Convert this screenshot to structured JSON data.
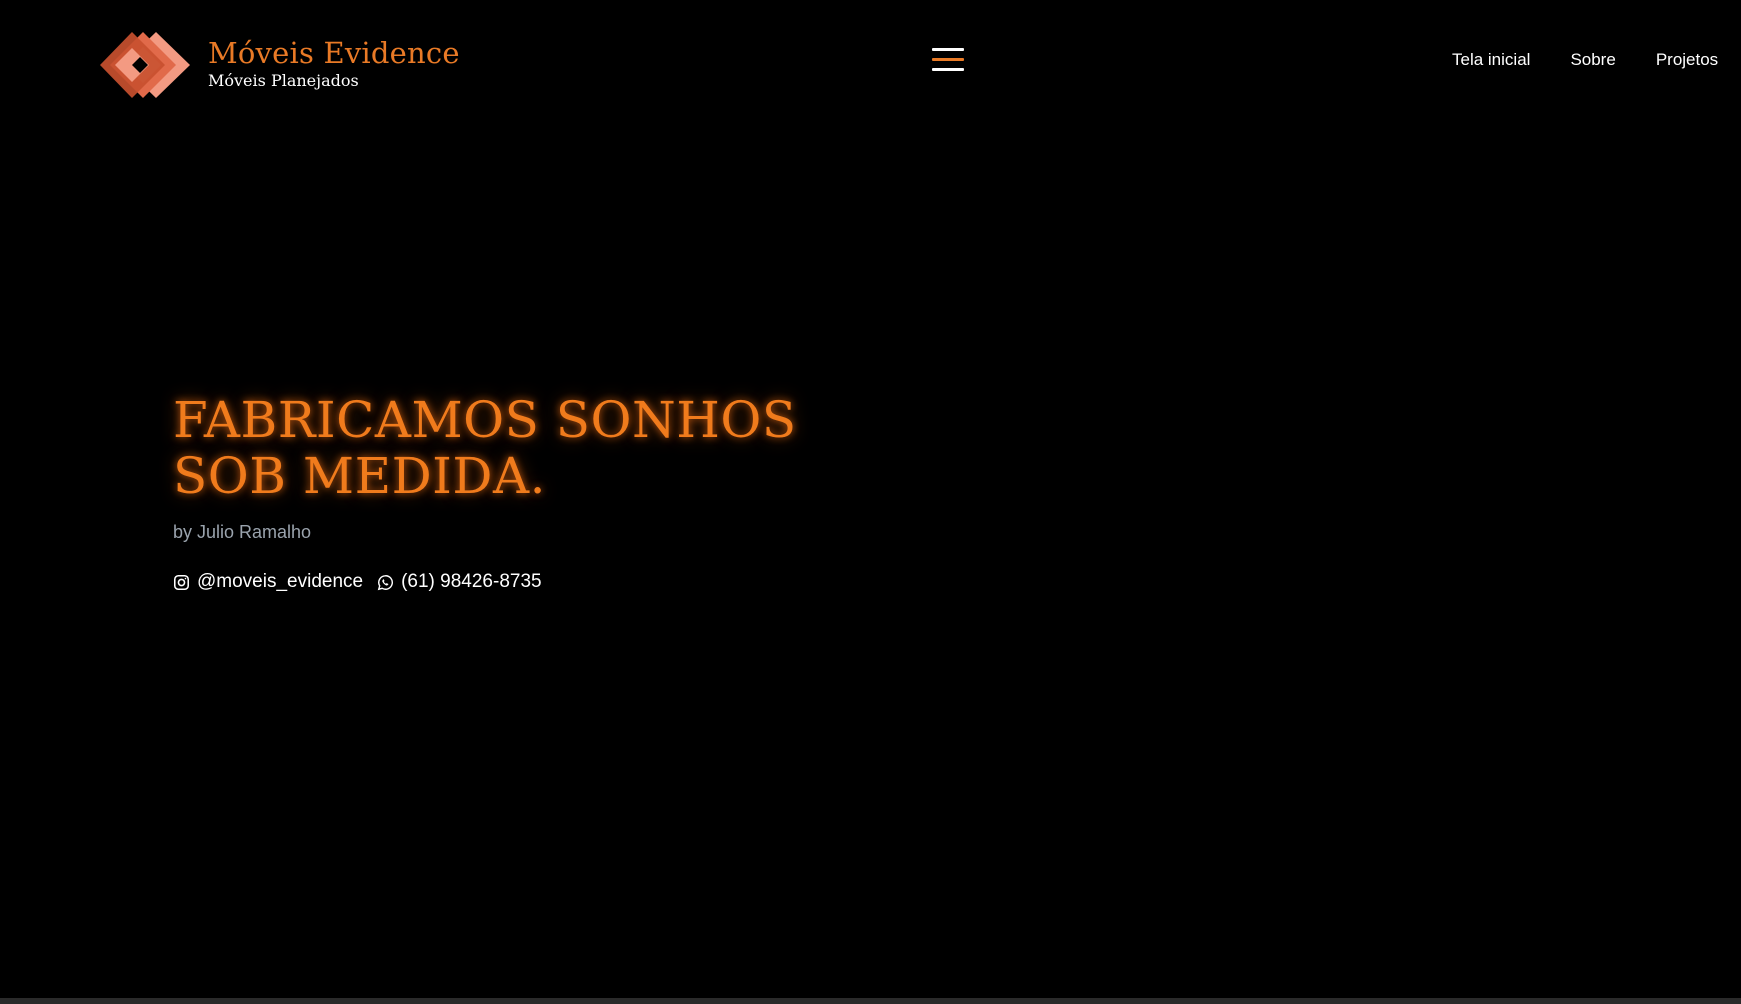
{
  "brand": {
    "name": "Móveis Evidence",
    "tagline": "Móveis Planejados",
    "logo_icon": "nested-diamond-logo-icon",
    "colors": {
      "accent": "#e97a26",
      "logo_dark": "#c8502f",
      "logo_mid": "#e16a4a",
      "logo_light": "#f39a82"
    }
  },
  "header": {
    "menu_icon": "hamburger-menu-icon",
    "nav": [
      {
        "label": "Tela inicial"
      },
      {
        "label": "Sobre"
      },
      {
        "label": "Projetos"
      }
    ]
  },
  "hero": {
    "title_line1": "FABRICAMOS SONHOS",
    "title_line2": "SOB MEDIDA.",
    "byline": "by Julio Ramalho",
    "title_color": "#f07b1c",
    "contacts": {
      "instagram": {
        "icon": "instagram-icon",
        "label": "@moveis_evidence"
      },
      "whatsapp": {
        "icon": "whatsapp-icon",
        "label": "(61) 98426-8735"
      }
    }
  },
  "theme": {
    "background": "#000000",
    "byline_color": "#9aa3ad"
  }
}
